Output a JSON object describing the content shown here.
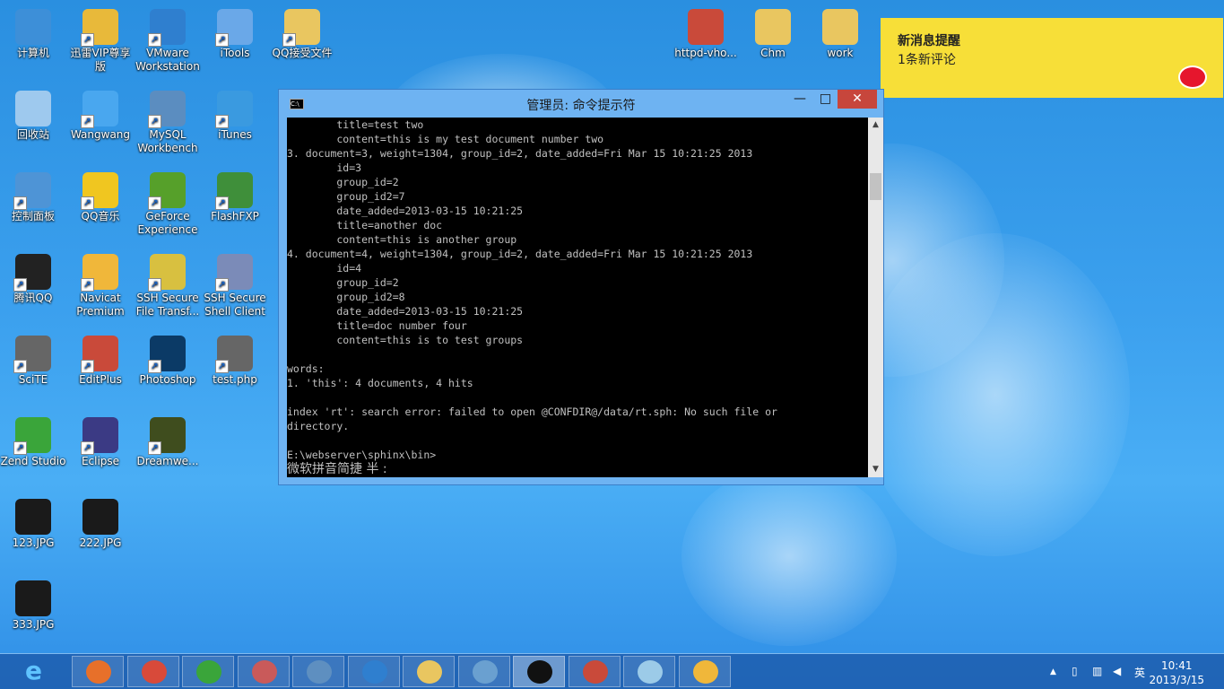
{
  "desktop_icons": [
    {
      "label": "计算机",
      "icon": "computer-icon",
      "color": "#3d8fd8"
    },
    {
      "label": "迅雷VIP尊享版",
      "icon": "thunder-icon",
      "color": "#e8b93a"
    },
    {
      "label": "VMware Workstation",
      "icon": "vmware-icon",
      "color": "#2f7fcf"
    },
    {
      "label": "iTools",
      "icon": "itools-icon",
      "color": "#6aa8e8"
    },
    {
      "label": "QQ接受文件",
      "icon": "folder-icon",
      "color": "#e9c660"
    },
    {
      "label": "回收站",
      "icon": "recycle-bin-icon",
      "color": "#9ec9ee"
    },
    {
      "label": "Wangwang",
      "icon": "wangwang-icon",
      "color": "#49a7ef"
    },
    {
      "label": "MySQL Workbench",
      "icon": "mysql-workbench-icon",
      "color": "#5b8dc0"
    },
    {
      "label": "iTunes",
      "icon": "itunes-icon",
      "color": "#3a9ae0"
    },
    {
      "label": "控制面板",
      "icon": "control-panel-icon",
      "color": "#4e94d6"
    },
    {
      "label": "QQ音乐",
      "icon": "qq-music-icon",
      "color": "#f0c620"
    },
    {
      "label": "GeForce Experience",
      "icon": "geforce-icon",
      "color": "#56a02a"
    },
    {
      "label": "FlashFXP",
      "icon": "flashfxp-icon",
      "color": "#3f8f3a"
    },
    {
      "label": "腾讯QQ",
      "icon": "qq-penguin-icon",
      "color": "#222222"
    },
    {
      "label": "Navicat Premium",
      "icon": "navicat-icon",
      "color": "#f0b73a"
    },
    {
      "label": "SSH Secure File Transf...",
      "icon": "ssh-file-transfer-icon",
      "color": "#d8c040"
    },
    {
      "label": "SSH Secure Shell Client",
      "icon": "ssh-shell-icon",
      "color": "#7b8bb8"
    },
    {
      "label": "SciTE",
      "icon": "scite-icon",
      "color": "#666666"
    },
    {
      "label": "EditPlus",
      "icon": "editplus-icon",
      "color": "#c94a3a"
    },
    {
      "label": "Photoshop",
      "icon": "photoshop-icon",
      "color": "#0b3a66"
    },
    {
      "label": "test.php",
      "icon": "php-file-icon",
      "color": "#666666"
    },
    {
      "label": "Zend Studio",
      "icon": "zend-studio-icon",
      "color": "#3aa53a"
    },
    {
      "label": "Eclipse",
      "icon": "eclipse-icon",
      "color": "#3b3a84"
    },
    {
      "label": "Dreamwe...",
      "icon": "dreamweaver-icon",
      "color": "#3f4d1e"
    },
    {
      "label": "123.JPG",
      "icon": "jpg-file-icon",
      "color": "#1a1a1a"
    },
    {
      "label": "222.JPG",
      "icon": "jpg-file-icon",
      "color": "#1a1a1a"
    },
    {
      "label": "333.JPG",
      "icon": "jpg-file-icon",
      "color": "#1a1a1a"
    },
    {
      "label": "httpd-vho...",
      "icon": "editplus-file-icon",
      "color": "#c94a3a"
    },
    {
      "label": "Chm",
      "icon": "folder-icon",
      "color": "#e9c660"
    },
    {
      "label": "work",
      "icon": "folder-icon",
      "color": "#e9c660"
    }
  ],
  "notification": {
    "title": "新消息提醒",
    "message": "1条新评论",
    "icon": "weibo-icon",
    "bg_color": "#f7df38"
  },
  "cmd_window": {
    "title": "管理员: 命令提示符",
    "system_icon": "cmd-icon",
    "minimize_glyph": "—",
    "maximize_glyph": "□",
    "close_glyph": "✕",
    "lines": [
      "        title=test two",
      "        content=this is my test document number two",
      "3. document=3, weight=1304, group_id=2, date_added=Fri Mar 15 10:21:25 2013",
      "        id=3",
      "        group_id=2",
      "        group_id2=7",
      "        date_added=2013-03-15 10:21:25",
      "        title=another doc",
      "        content=this is another group",
      "4. document=4, weight=1304, group_id=2, date_added=Fri Mar 15 10:21:25 2013",
      "        id=4",
      "        group_id=2",
      "        group_id2=8",
      "        date_added=2013-03-15 10:21:25",
      "        title=doc number four",
      "        content=this is to test groups",
      "",
      "words:",
      "1. 'this': 4 documents, 4 hits",
      "",
      "index 'rt': search error: failed to open @CONFDIR@/data/rt.sph: No such file or",
      "directory.",
      "",
      "E:\\webserver\\sphinx\\bin>"
    ],
    "ime_status": "微软拼音简捷 半 :"
  },
  "taskbar": {
    "start_icon": "ie-icon",
    "items": [
      {
        "name": "ie",
        "icon": "internet-explorer-icon",
        "color": "#3a9ae0",
        "active": false
      },
      {
        "name": "firefox",
        "icon": "firefox-icon",
        "color": "#e7702a",
        "active": false
      },
      {
        "name": "chrome",
        "icon": "chrome-icon",
        "color": "#d84a3a",
        "active": false
      },
      {
        "name": "360",
        "icon": "green-ball-icon",
        "color": "#3aa53a",
        "active": false
      },
      {
        "name": "snipping",
        "icon": "scissors-icon",
        "color": "#c95a5a",
        "active": false
      },
      {
        "name": "globe",
        "icon": "globe-icon",
        "color": "#5e8fc0",
        "active": false
      },
      {
        "name": "vmware",
        "icon": "vmware-taskbar-icon",
        "color": "#2f7fcf",
        "active": false
      },
      {
        "name": "explorer",
        "icon": "file-explorer-icon",
        "color": "#e9c660",
        "active": false
      },
      {
        "name": "remote",
        "icon": "remote-desktop-icon",
        "color": "#6aa0d0",
        "active": false
      },
      {
        "name": "cmd",
        "icon": "command-prompt-icon",
        "color": "#111111",
        "active": true
      },
      {
        "name": "editplus",
        "icon": "editplus-taskbar-icon",
        "color": "#c94a3a",
        "active": false
      },
      {
        "name": "notepad",
        "icon": "notepad-icon",
        "color": "#9ccbe8",
        "active": false
      },
      {
        "name": "navicat",
        "icon": "navicat-taskbar-icon",
        "color": "#f0b73a",
        "active": false
      }
    ],
    "tray": {
      "arrow": "▲",
      "ime_lang": "英",
      "time": "10:41",
      "date": "2013/3/15"
    }
  }
}
